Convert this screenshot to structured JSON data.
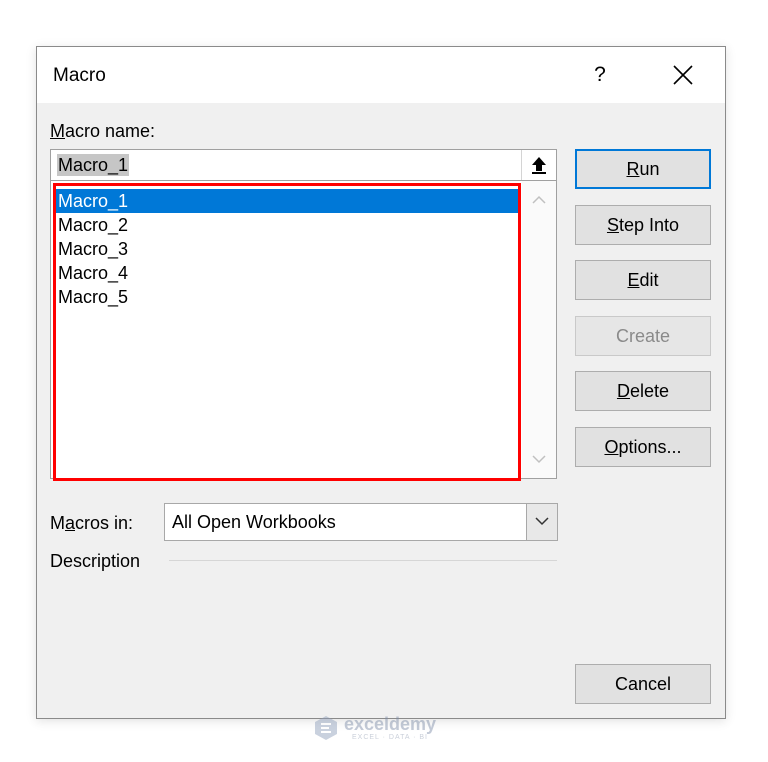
{
  "window": {
    "title": "Macro",
    "help": "?"
  },
  "macro_name": {
    "label_acc": "M",
    "label_rest": "acro name:",
    "value": "Macro_1"
  },
  "macro_list": {
    "items": [
      "Macro_1",
      "Macro_2",
      "Macro_3",
      "Macro_4",
      "Macro_5"
    ],
    "selected_index": 0
  },
  "buttons": {
    "run": {
      "acc": "R",
      "rest": "un"
    },
    "step_into": {
      "acc": "S",
      "rest": "tep Into"
    },
    "edit": {
      "acc": "E",
      "rest": "dit"
    },
    "create": {
      "label": "Create"
    },
    "delete": {
      "acc": "D",
      "rest": "elete"
    },
    "options": {
      "acc": "O",
      "rest": "ptions..."
    },
    "cancel": {
      "label": "Cancel"
    }
  },
  "macros_in": {
    "label_pre": "M",
    "label_acc": "a",
    "label_rest": "cros in:",
    "value": "All Open Workbooks"
  },
  "description": {
    "label": "Description"
  },
  "watermark": {
    "brand": "exceldemy",
    "tagline": "EXCEL · DATA · BI"
  },
  "colors": {
    "selection": "#0078d7",
    "highlight_box": "#ff0000"
  }
}
